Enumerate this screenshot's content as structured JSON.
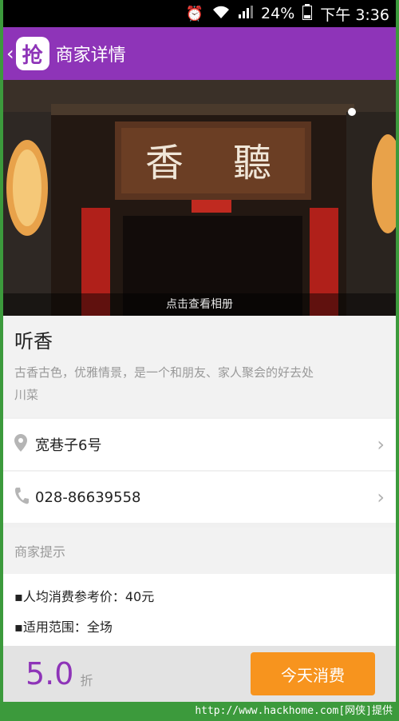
{
  "status_bar": {
    "battery": "24%",
    "time": "下午 3:36"
  },
  "app_bar": {
    "back_icon": "‹",
    "logo_char": "抢",
    "title": "商家详情"
  },
  "hero": {
    "caption": "点击查看相册"
  },
  "merchant": {
    "name": "听香",
    "description": "古香古色，优雅情景，是一个和朋友、家人聚会的好去处",
    "category": "川菜"
  },
  "address": {
    "text": "宽巷子6号",
    "icon": "location-pin-icon"
  },
  "phone": {
    "text": "028-86639558",
    "icon": "phone-icon"
  },
  "tips": {
    "heading": "商家提示",
    "items": [
      "▪人均消费参考价：40元",
      "▪适用范围：全场"
    ]
  },
  "bottom_bar": {
    "discount": "5.0",
    "unit": "折",
    "button_label": "今天消费"
  },
  "footer": {
    "watermark": "http://www.hackhome.com[网侠]提供"
  },
  "colors": {
    "brand": "#8e34b8",
    "action": "#f7941e",
    "frame": "#3c9a3c"
  }
}
